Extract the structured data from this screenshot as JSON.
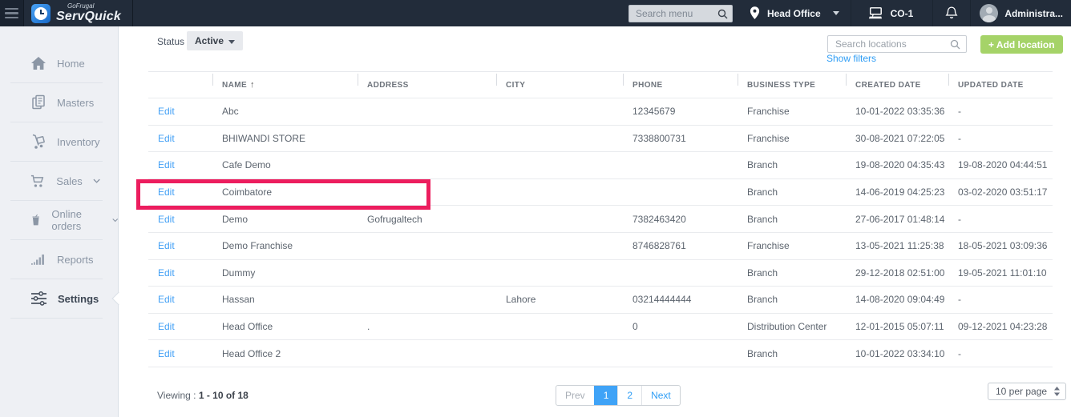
{
  "header": {
    "logo_small": "GoFrugal",
    "logo_main": "ServQuick",
    "search_placeholder": "Search menu",
    "location": "Head Office",
    "terminal": "CO-1",
    "user": "Administra..."
  },
  "sidebar": {
    "items": [
      {
        "label": "Home",
        "icon": "home-icon",
        "active": false
      },
      {
        "label": "Masters",
        "icon": "masters-icon",
        "active": false
      },
      {
        "label": "Inventory",
        "icon": "inventory-icon",
        "active": false
      },
      {
        "label": "Sales",
        "icon": "sales-icon",
        "expandable": true,
        "active": false
      },
      {
        "label": "Online orders",
        "icon": "online-orders-icon",
        "expandable": true,
        "active": false
      },
      {
        "label": "Reports",
        "icon": "reports-icon",
        "active": false
      },
      {
        "label": "Settings",
        "icon": "settings-icon",
        "active": true
      }
    ]
  },
  "toolbar": {
    "status_label": "Status",
    "status_value": "Active",
    "search_placeholder": "Search locations",
    "add_button": "+ Add location",
    "show_filters": "Show filters"
  },
  "table": {
    "edit_label": "Edit",
    "columns": [
      "",
      "NAME",
      "ADDRESS",
      "CITY",
      "PHONE",
      "BUSINESS TYPE",
      "CREATED DATE",
      "UPDATED DATE"
    ],
    "sort_column": "NAME",
    "sort_direction": "asc",
    "rows": [
      {
        "name": "Abc",
        "address": "",
        "city": "",
        "phone": "12345679",
        "business_type": "Franchise",
        "created": "10-01-2022 03:35:36",
        "updated": "-"
      },
      {
        "name": "BHIWANDI STORE",
        "address": "",
        "city": "",
        "phone": "7338800731",
        "business_type": "Franchise",
        "created": "30-08-2021 07:22:05",
        "updated": "-"
      },
      {
        "name": "Cafe Demo",
        "address": "",
        "city": "",
        "phone": "",
        "business_type": "Branch",
        "created": "19-08-2020 04:35:43",
        "updated": "19-08-2020 04:44:51"
      },
      {
        "name": "Coimbatore",
        "address": "",
        "city": "",
        "phone": "",
        "business_type": "Branch",
        "created": "14-06-2019 04:25:23",
        "updated": "03-02-2020 03:51:17",
        "highlighted": true
      },
      {
        "name": "Demo",
        "address": "Gofrugaltech",
        "city": "",
        "phone": "7382463420",
        "business_type": "Branch",
        "created": "27-06-2017 01:48:14",
        "updated": "-"
      },
      {
        "name": "Demo Franchise",
        "address": "",
        "city": "",
        "phone": "8746828761",
        "business_type": "Franchise",
        "created": "13-05-2021 11:25:38",
        "updated": "18-05-2021 03:09:36"
      },
      {
        "name": "Dummy",
        "address": "",
        "city": "",
        "phone": "",
        "business_type": "Branch",
        "created": "29-12-2018 02:51:00",
        "updated": "19-05-2021 11:01:10"
      },
      {
        "name": "Hassan",
        "address": "",
        "city": "Lahore",
        "phone": "03214444444",
        "business_type": "Branch",
        "created": "14-08-2020 09:04:49",
        "updated": "-"
      },
      {
        "name": "Head Office",
        "address": ".",
        "city": "",
        "phone": "0",
        "business_type": "Distribution Center",
        "created": "12-01-2015 05:07:11",
        "updated": "09-12-2021 04:23:28"
      },
      {
        "name": "Head Office 2",
        "address": "",
        "city": "",
        "phone": "",
        "business_type": "Branch",
        "created": "10-01-2022 03:34:10",
        "updated": "-"
      }
    ]
  },
  "footer": {
    "viewing_label": "Viewing :",
    "viewing_value": "1 - 10 of 18",
    "pagination": [
      "Prev",
      "1",
      "2",
      "Next"
    ],
    "active_page": "1",
    "per_page": "10 per page"
  },
  "colors": {
    "header_bg": "#222c3a",
    "sidebar_bg": "#eef0f4",
    "accent_blue": "#42a0f5",
    "accent_green": "#a5d368",
    "highlight_pink": "#ec1d5e"
  }
}
